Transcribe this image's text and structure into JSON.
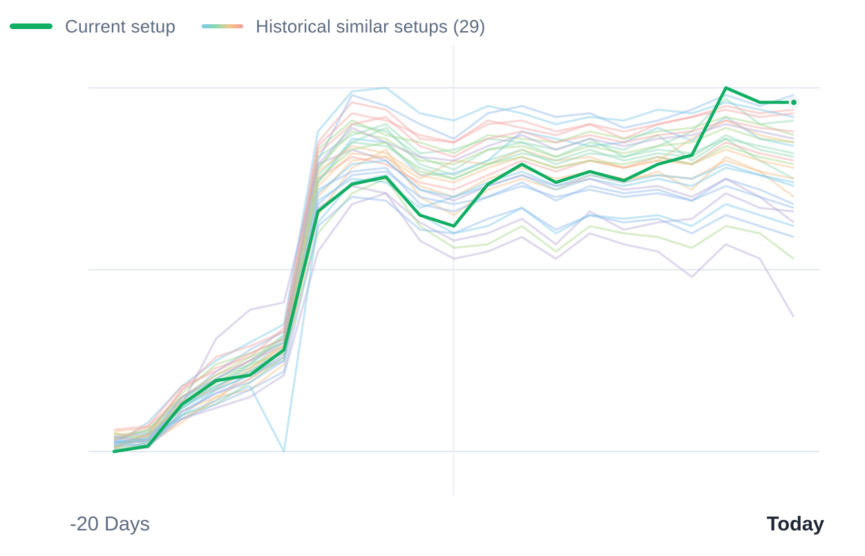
{
  "legend": {
    "current_label": "Current setup",
    "historical_label": "Historical similar setups (29)"
  },
  "colors": {
    "current": "#0fae63",
    "grid": "#e3e7f0",
    "historical_palette": [
      "#7cc7e8",
      "#8fd8b4",
      "#f5c08c",
      "#f3a3a3",
      "#8fb8ee",
      "#b7a9d6",
      "#a8d88a"
    ]
  },
  "chart_data": {
    "type": "line",
    "x_start_label": "-20 Days",
    "x_end_label": "Today",
    "x": [
      -20,
      -19,
      -18,
      -17,
      -16,
      -15,
      -14,
      -13,
      -12,
      -11,
      -10,
      -9,
      -8,
      -7,
      -6,
      -5,
      -4,
      -3,
      -2,
      -1,
      0
    ],
    "xlim": [
      -20,
      0
    ],
    "ylim": [
      0,
      1
    ],
    "grid": "on",
    "legend_position": "top-left",
    "current": [
      0.0,
      0.03,
      0.26,
      0.39,
      0.42,
      0.56,
      1.32,
      1.47,
      1.51,
      1.3,
      1.24,
      1.47,
      1.58,
      1.48,
      1.54,
      1.49,
      1.58,
      1.63,
      2.0,
      1.92,
      1.92
    ],
    "historical": [
      [
        0.05,
        0.06,
        0.25,
        0.35,
        0.48,
        0.62,
        1.48,
        1.72,
        1.7,
        1.52,
        1.53,
        1.6,
        1.76,
        1.72,
        1.68,
        1.7,
        1.78,
        1.71,
        1.84,
        1.72,
        1.68
      ],
      [
        0.02,
        0.08,
        0.3,
        0.4,
        0.5,
        0.64,
        1.55,
        1.8,
        1.76,
        1.62,
        1.55,
        1.66,
        1.7,
        1.66,
        1.72,
        1.62,
        1.68,
        1.76,
        1.94,
        1.8,
        1.82
      ],
      [
        0.08,
        0.04,
        0.18,
        0.28,
        0.45,
        0.58,
        1.4,
        1.6,
        1.62,
        1.5,
        1.6,
        1.58,
        1.66,
        1.6,
        1.62,
        1.56,
        1.6,
        1.72,
        1.82,
        1.74,
        1.7
      ],
      [
        0.03,
        0.1,
        0.34,
        0.46,
        0.52,
        0.68,
        1.7,
        1.92,
        1.88,
        1.72,
        1.7,
        1.82,
        1.78,
        1.74,
        1.8,
        1.72,
        1.8,
        1.84,
        1.9,
        1.86,
        1.88
      ],
      [
        0.06,
        0.12,
        0.28,
        0.44,
        0.56,
        0.66,
        1.6,
        1.96,
        1.9,
        1.8,
        1.72,
        1.86,
        1.9,
        1.84,
        1.86,
        1.78,
        1.82,
        1.88,
        1.96,
        1.9,
        1.96
      ],
      [
        0.01,
        0.02,
        0.22,
        0.32,
        0.4,
        0.54,
        1.34,
        1.46,
        1.42,
        1.26,
        1.16,
        1.2,
        1.28,
        1.14,
        1.32,
        1.22,
        1.26,
        1.28,
        1.42,
        1.34,
        1.32
      ],
      [
        0.1,
        0.06,
        0.2,
        0.26,
        0.38,
        0.52,
        1.2,
        1.42,
        1.5,
        1.24,
        1.12,
        1.14,
        1.24,
        1.1,
        1.24,
        1.2,
        1.18,
        1.12,
        1.24,
        1.2,
        1.06
      ],
      [
        0.04,
        0.16,
        0.36,
        0.5,
        0.6,
        0.7,
        1.76,
        1.98,
        2.0,
        1.86,
        1.82,
        1.9,
        1.86,
        1.8,
        1.84,
        1.82,
        1.88,
        1.86,
        1.92,
        1.88,
        1.84
      ],
      [
        0.07,
        0.09,
        0.24,
        0.38,
        0.46,
        0.6,
        1.62,
        1.74,
        1.8,
        1.64,
        1.66,
        1.72,
        1.7,
        1.62,
        1.7,
        1.66,
        1.74,
        1.6,
        1.72,
        1.6,
        1.5
      ],
      [
        0.02,
        0.04,
        0.16,
        0.3,
        0.34,
        0.48,
        1.3,
        1.56,
        1.66,
        1.4,
        1.3,
        1.44,
        1.5,
        1.44,
        1.52,
        1.48,
        1.54,
        1.44,
        1.62,
        1.54,
        1.4
      ],
      [
        0.12,
        0.14,
        0.3,
        0.42,
        0.5,
        0.58,
        1.5,
        1.62,
        1.58,
        1.48,
        1.44,
        1.52,
        1.6,
        1.54,
        1.6,
        1.56,
        1.62,
        1.58,
        1.7,
        1.64,
        1.6
      ],
      [
        0.05,
        0.08,
        0.26,
        0.36,
        0.44,
        0.56,
        1.44,
        1.54,
        1.56,
        1.36,
        1.32,
        1.4,
        1.48,
        1.38,
        1.46,
        1.42,
        1.44,
        1.38,
        1.5,
        1.44,
        1.36
      ],
      [
        0.0,
        0.03,
        0.18,
        0.24,
        0.3,
        0.42,
        1.1,
        1.36,
        1.42,
        1.16,
        1.06,
        1.1,
        1.18,
        1.06,
        1.2,
        1.14,
        1.1,
        0.96,
        1.14,
        1.06,
        0.74
      ],
      [
        0.09,
        0.11,
        0.32,
        0.48,
        0.54,
        0.62,
        1.66,
        1.82,
        1.74,
        1.7,
        1.64,
        1.74,
        1.72,
        1.7,
        1.76,
        1.72,
        1.76,
        1.78,
        1.84,
        1.8,
        1.74
      ],
      [
        0.06,
        0.05,
        0.2,
        0.34,
        0.42,
        0.5,
        1.38,
        1.5,
        1.48,
        1.34,
        1.4,
        1.46,
        1.52,
        1.44,
        1.5,
        1.46,
        1.5,
        1.46,
        1.56,
        1.52,
        1.46
      ],
      [
        0.03,
        0.07,
        0.28,
        0.4,
        0.48,
        0.64,
        1.52,
        1.7,
        1.68,
        1.56,
        1.5,
        1.58,
        1.64,
        1.6,
        1.66,
        1.6,
        1.64,
        1.62,
        1.74,
        1.66,
        1.62
      ],
      [
        0.11,
        0.13,
        0.22,
        0.3,
        0.4,
        0.52,
        1.46,
        1.64,
        1.62,
        1.46,
        1.4,
        1.5,
        1.56,
        1.5,
        1.54,
        1.5,
        1.52,
        1.5,
        1.6,
        1.54,
        1.5
      ],
      [
        0.02,
        0.09,
        0.34,
        0.52,
        0.58,
        0.66,
        1.68,
        1.86,
        1.82,
        1.74,
        1.7,
        1.8,
        1.82,
        1.76,
        1.8,
        1.76,
        1.8,
        1.84,
        1.88,
        1.84,
        1.86
      ],
      [
        0.08,
        0.1,
        0.18,
        0.26,
        0.34,
        0.44,
        1.24,
        1.4,
        1.38,
        1.22,
        1.2,
        1.28,
        1.34,
        1.22,
        1.3,
        1.26,
        1.28,
        1.2,
        1.3,
        1.24,
        1.18
      ],
      [
        0.04,
        0.06,
        0.26,
        0.62,
        0.78,
        0.82,
        1.58,
        1.66,
        1.6,
        1.44,
        1.38,
        1.46,
        1.52,
        1.46,
        1.5,
        1.44,
        1.46,
        1.4,
        1.5,
        1.4,
        1.26
      ],
      [
        0.07,
        0.12,
        0.3,
        0.42,
        0.52,
        0.6,
        1.56,
        1.76,
        1.72,
        1.6,
        1.58,
        1.66,
        1.68,
        1.62,
        1.68,
        1.64,
        1.68,
        1.7,
        1.78,
        1.72,
        1.7
      ],
      [
        0.05,
        0.03,
        0.2,
        0.28,
        0.36,
        0.0,
        1.26,
        1.48,
        1.52,
        1.3,
        1.2,
        1.24,
        1.34,
        1.2,
        1.3,
        1.28,
        1.3,
        1.24,
        1.36,
        1.3,
        1.24
      ],
      [
        0.01,
        0.05,
        0.24,
        0.36,
        0.44,
        0.56,
        1.48,
        1.7,
        1.78,
        1.58,
        1.52,
        1.6,
        1.66,
        1.58,
        1.64,
        1.62,
        1.66,
        1.64,
        1.72,
        1.68,
        1.64
      ],
      [
        0.1,
        0.08,
        0.28,
        0.34,
        0.46,
        0.58,
        1.54,
        1.68,
        1.64,
        1.52,
        1.48,
        1.56,
        1.62,
        1.56,
        1.6,
        1.56,
        1.6,
        1.58,
        1.66,
        1.6,
        1.56
      ],
      [
        0.06,
        0.14,
        0.36,
        0.44,
        0.54,
        0.62,
        1.64,
        1.8,
        1.84,
        1.68,
        1.62,
        1.72,
        1.76,
        1.7,
        1.74,
        1.7,
        1.74,
        1.76,
        1.82,
        1.78,
        1.76
      ],
      [
        0.03,
        0.04,
        0.22,
        0.32,
        0.38,
        0.5,
        1.36,
        1.52,
        1.54,
        1.4,
        1.36,
        1.4,
        1.46,
        1.4,
        1.44,
        1.4,
        1.42,
        1.38,
        1.46,
        1.4,
        1.34
      ],
      [
        0.08,
        0.06,
        0.3,
        0.4,
        0.5,
        0.6,
        1.58,
        1.78,
        1.7,
        1.62,
        1.6,
        1.68,
        1.74,
        1.66,
        1.72,
        1.68,
        1.72,
        1.74,
        1.8,
        1.76,
        1.72
      ],
      [
        0.02,
        0.1,
        0.26,
        0.38,
        0.48,
        0.54,
        1.5,
        1.66,
        1.7,
        1.54,
        1.5,
        1.58,
        1.62,
        1.56,
        1.6,
        1.58,
        1.62,
        1.58,
        1.68,
        1.62,
        1.58
      ],
      [
        0.05,
        0.07,
        0.24,
        0.34,
        0.42,
        0.52,
        1.42,
        1.58,
        1.6,
        1.44,
        1.4,
        1.48,
        1.54,
        1.46,
        1.52,
        1.48,
        1.52,
        1.5,
        1.58,
        1.52,
        1.48
      ]
    ]
  }
}
